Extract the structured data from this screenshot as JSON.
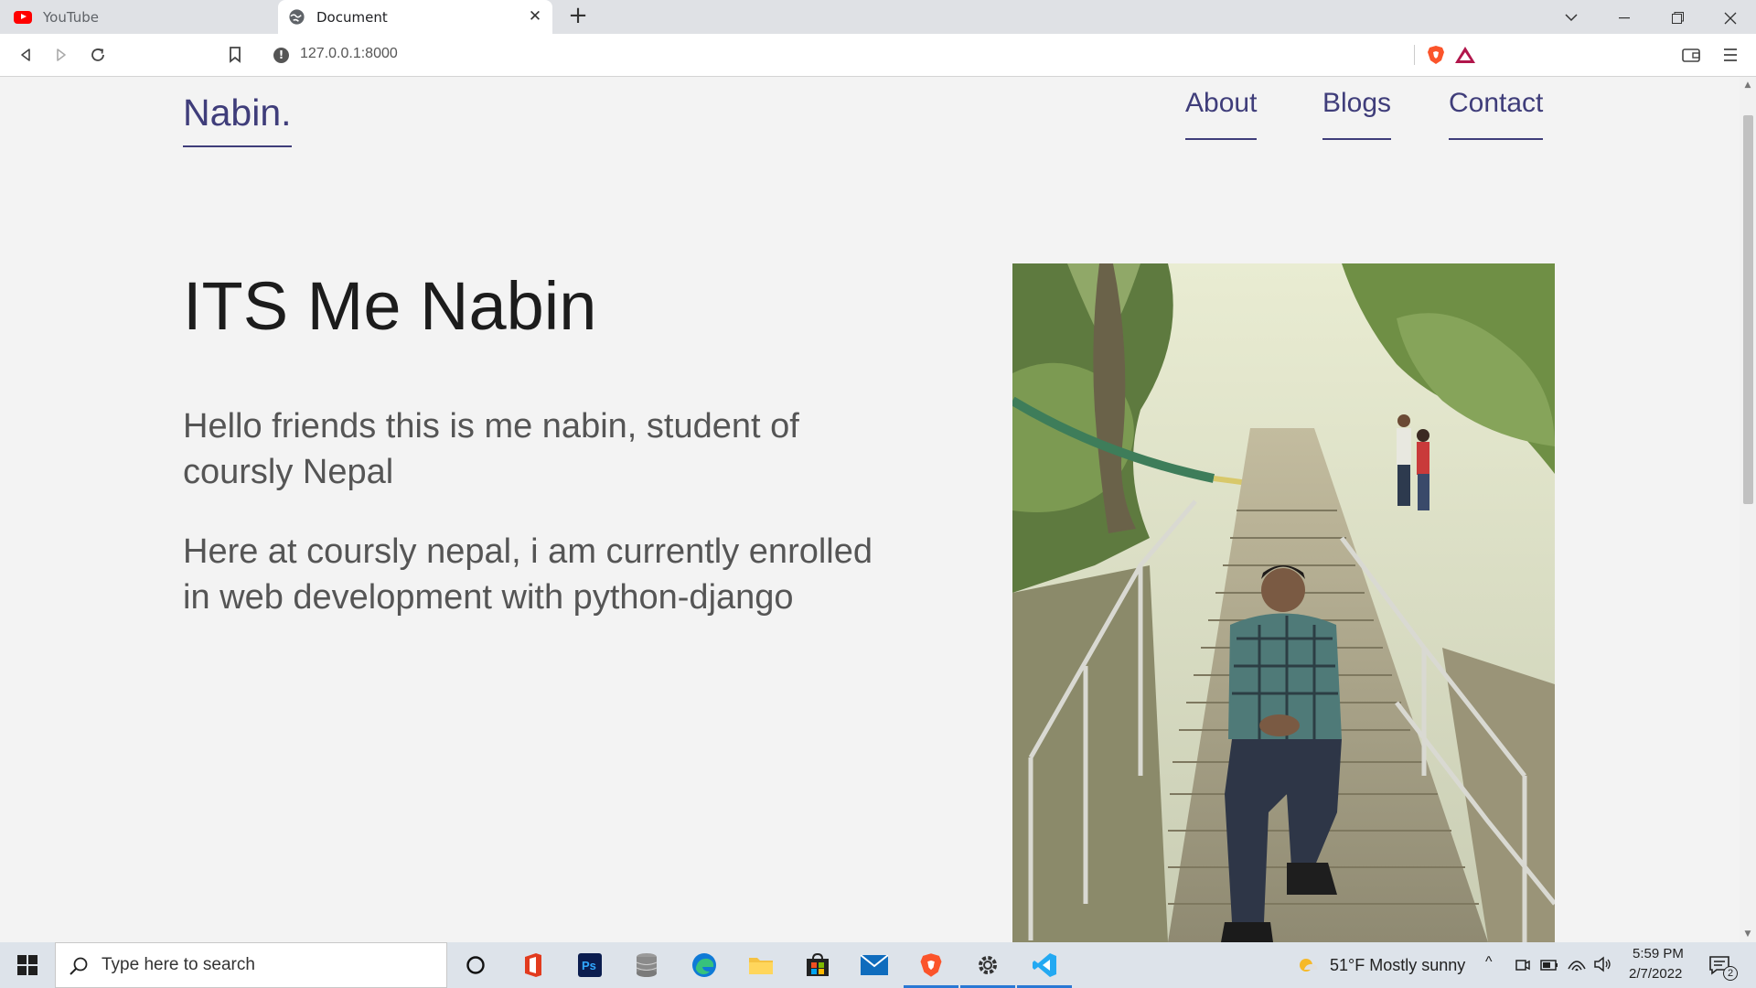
{
  "browser": {
    "tabs": [
      {
        "title": "YouTube",
        "active": false
      },
      {
        "title": "Document",
        "active": true
      }
    ],
    "url": "127.0.0.1:8000"
  },
  "site": {
    "logo": "Nabin.",
    "nav": [
      "About",
      "Blogs",
      "Contact"
    ],
    "hero_title": "ITS Me Nabin",
    "paragraphs": [
      "Hello friends this is me nabin, student of coursly Nepal",
      "Here at coursly nepal, i am currently enrolled in web development with python-django"
    ],
    "accent_color": "#3f3d7a"
  },
  "taskbar": {
    "search_placeholder": "Type here to search",
    "weather": "51°F  Mostly sunny",
    "time": "5:59 PM",
    "date": "2/7/2022",
    "notification_count": "2",
    "apps": [
      "cortana",
      "office",
      "photoshop",
      "database",
      "edge",
      "file-explorer",
      "store",
      "mail",
      "brave",
      "settings",
      "vscode"
    ]
  }
}
